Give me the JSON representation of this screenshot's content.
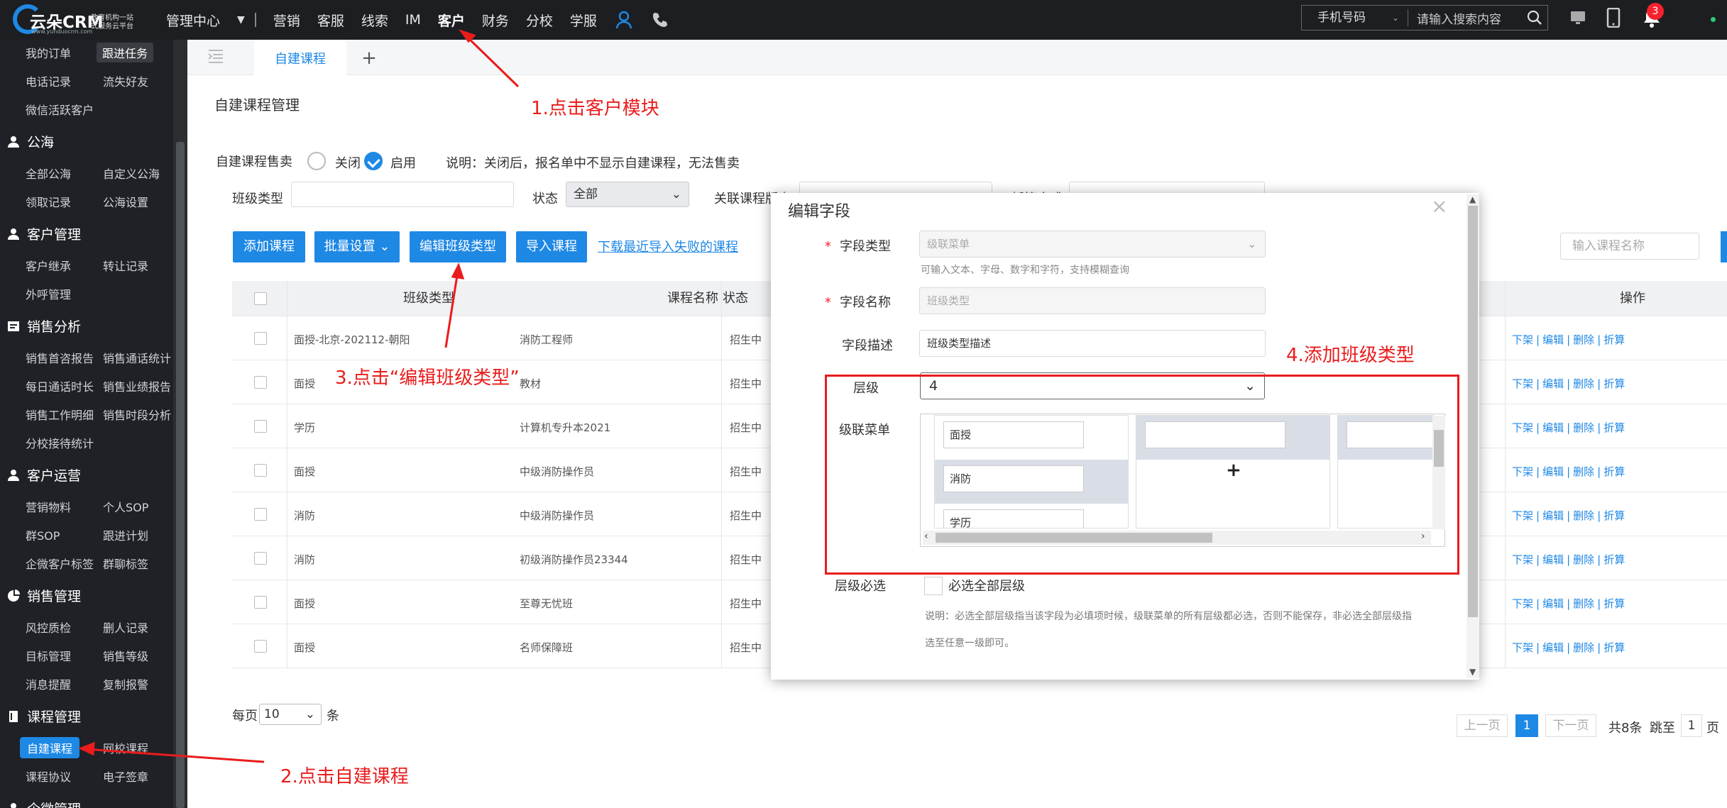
{
  "app": {
    "logo_text": "云朵CRM",
    "logo_slogan": "教育机构一站式服务云平台",
    "logo_url": "www.yunduocrm.com"
  },
  "nav": {
    "items": [
      "管理中心",
      "营销",
      "客服",
      "线索",
      "IM",
      "客户",
      "财务",
      "分校",
      "学服"
    ],
    "active": "客户"
  },
  "search": {
    "type_label": "手机号码",
    "placeholder": "请输入搜索内容"
  },
  "notify": {
    "count": "3"
  },
  "sidebar": {
    "top_items": [
      "我的订单",
      "跟进任务",
      "电话记录",
      "流失好友",
      "微信活跃客户"
    ],
    "sections": [
      {
        "title": "公海",
        "items": [
          "全部公海",
          "自定义公海",
          "领取记录",
          "公海设置"
        ]
      },
      {
        "title": "客户管理",
        "items": [
          "客户继承",
          "转让记录",
          "外呼管理"
        ]
      },
      {
        "title": "销售分析",
        "items": [
          "销售首咨报告",
          "销售通话统计",
          "每日通话时长",
          "销售业绩报告",
          "销售工作明细",
          "销售时段分析",
          "分校接待统计"
        ]
      },
      {
        "title": "客户运营",
        "items": [
          "营销物料",
          "个人SOP",
          "群SOP",
          "跟进计划",
          "企微客户标签",
          "群聊标签"
        ]
      },
      {
        "title": "销售管理",
        "items": [
          "风控质检",
          "删人记录",
          "目标管理",
          "销售等级",
          "消息提醒",
          "复制报警"
        ]
      },
      {
        "title": "课程管理",
        "items": [
          "自建课程",
          "网校课程",
          "课程协议",
          "电子签章"
        ]
      },
      {
        "title": "企微管理",
        "items": []
      }
    ]
  },
  "tabs": {
    "current": "自建课程",
    "add": "+"
  },
  "page": {
    "title": "自建课程管理",
    "sale_label": "自建课程售卖",
    "opt_off": "关闭",
    "opt_on": "启用",
    "note": "说明：关闭后，报名单中不显示自建课程，无法售卖",
    "filter_class_type": "班级类型",
    "filter_status": "状态",
    "filter_status_value": "全部",
    "filter_related": "关联课程版本",
    "filter_other": "折算方式",
    "btn_add": "添加课程",
    "btn_batch": "批量设置",
    "btn_edit_type": "编辑班级类型",
    "btn_import": "导入课程",
    "link_failed": "下载最近导入失败的课程",
    "search_placeholder": "输入课程名称"
  },
  "table": {
    "headers": [
      "班级类型",
      "课程名称",
      "状态",
      "操作"
    ],
    "rows": [
      {
        "type": "面授-北京-202112-朝阳",
        "name": "消防工程师",
        "status": "招生中"
      },
      {
        "type": "面授",
        "name": "教材",
        "status": "招生中"
      },
      {
        "type": "学历",
        "name": "计算机专升本2021",
        "status": "招生中"
      },
      {
        "type": "面授",
        "name": "中级消防操作员",
        "status": "招生中"
      },
      {
        "type": "消防",
        "name": "中级消防操作员",
        "status": "招生中"
      },
      {
        "type": "消防",
        "name": "初级消防操作员23344",
        "status": "招生中"
      },
      {
        "type": "面授",
        "name": "至尊无忧班",
        "status": "招生中"
      },
      {
        "type": "面授",
        "name": "名师保障班",
        "status": "招生中"
      }
    ],
    "ops": [
      "下架",
      "编辑",
      "删除",
      "折算"
    ]
  },
  "pager": {
    "per_page": "每页",
    "per_value": "10",
    "unit": "条",
    "prev": "上一页",
    "current": "1",
    "next": "下一页",
    "total": "共8条",
    "jump": "跳至",
    "jump_value": "1",
    "page_unit": "页"
  },
  "modal": {
    "title": "编辑字段",
    "field_type_label": "字段类型",
    "field_type_value": "级联菜单",
    "field_type_hint": "可输入文本、字母、数字和字符，支持模糊查询",
    "field_name_label": "字段名称",
    "field_name_value": "班级类型",
    "field_desc_label": "字段描述",
    "field_desc_value": "班级类型描述",
    "level_label": "层级",
    "level_value": "4",
    "cascade_label": "级联菜单",
    "cascade_col1": [
      "面授",
      "消防",
      "学历"
    ],
    "required_label": "层级必选",
    "required_option": "必选全部层级",
    "note1": "说明：必选全部层级指当该字段为必填项时候，级联菜单的所有层级都必选，否则不能保存，非必选全部层级指",
    "note2": "选至任意一级即可。"
  },
  "annotations": {
    "a1": "1.点击客户模块",
    "a2": "2.点击自建课程",
    "a3": "3.点击“编辑班级类型”",
    "a4": "4.添加班级类型"
  },
  "colors": {
    "accent": "#1e88e5",
    "annotation": "#ea1c1c",
    "topbar": "#1c1e22",
    "sidebar": "#1f2126"
  }
}
